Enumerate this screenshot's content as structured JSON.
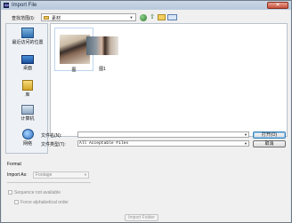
{
  "window": {
    "title": "Import File",
    "close_label": "✕"
  },
  "lookin": {
    "label": "查找范围(I):",
    "value": "素材"
  },
  "places": [
    {
      "label": "最近访问的位置",
      "icon": "recent-places-icon"
    },
    {
      "label": "桌面",
      "icon": "desktop-icon"
    },
    {
      "label": "库",
      "icon": "libraries-icon"
    },
    {
      "label": "计算机",
      "icon": "computer-icon"
    },
    {
      "label": "网络",
      "icon": "network-icon"
    }
  ],
  "files": [
    {
      "name": "图",
      "selected": true
    },
    {
      "name": "图1",
      "selected": false
    }
  ],
  "filename": {
    "label": "文件名(N):",
    "value": ""
  },
  "filetype": {
    "label": "文件类型(T):",
    "value": "All Acceptable Files"
  },
  "buttons": {
    "open": "打开(O)",
    "cancel": "取消",
    "import_folder": "Import Folder"
  },
  "format": {
    "label": "Format"
  },
  "import_as": {
    "label": "Import As:",
    "value": "Footage"
  },
  "options": {
    "sequence": "Sequence not available",
    "alphabetical": "Force alphabetical order"
  },
  "colors": {
    "title_bar": "#b8c9dc",
    "close_button": "#c6503a",
    "selection_border": "#bcd5ef"
  }
}
